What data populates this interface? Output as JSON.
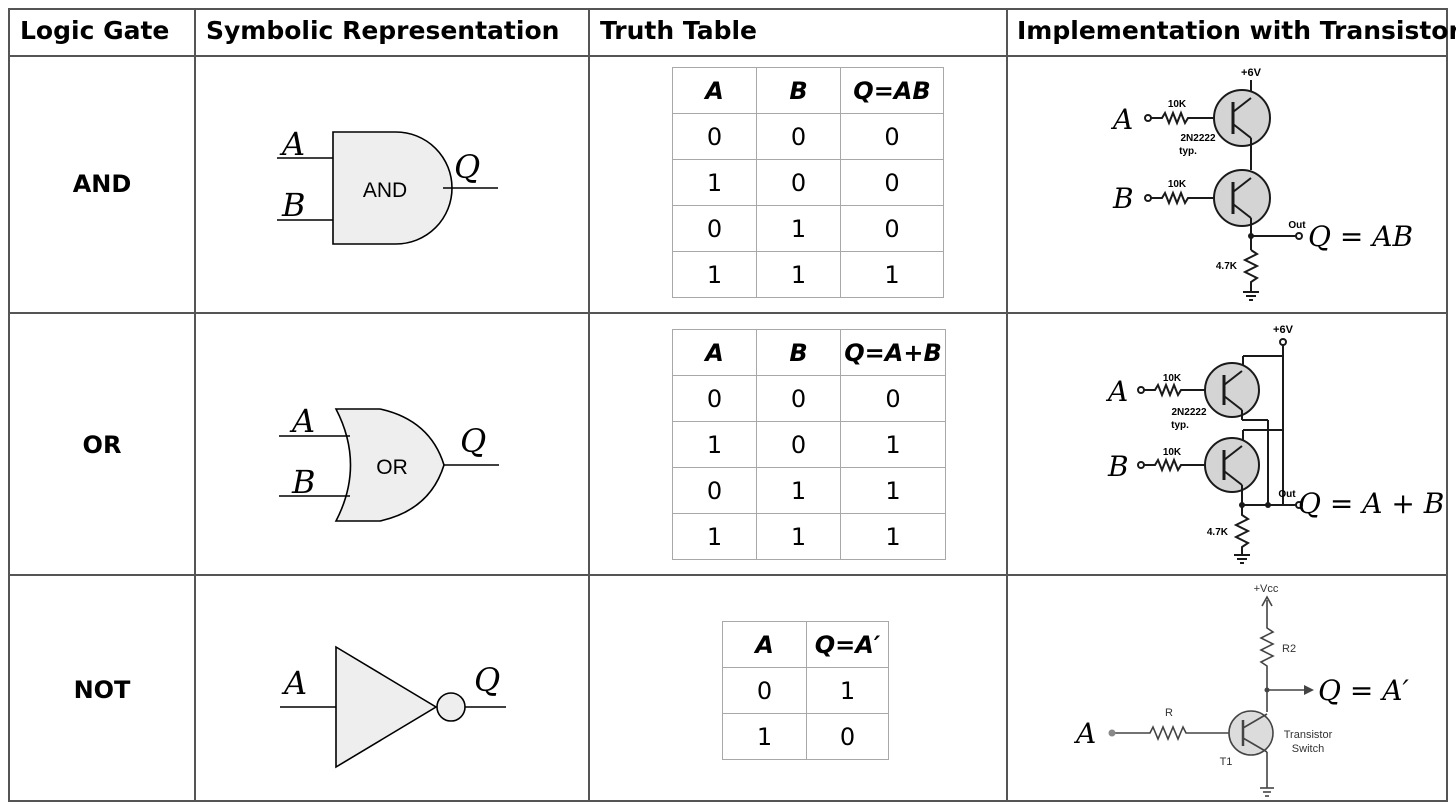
{
  "headers": {
    "gate": "Logic Gate",
    "symbol": "Symbolic Representation",
    "truth": "Truth Table",
    "impl": "Implementation with Transistors"
  },
  "rows": [
    {
      "gate": "AND",
      "symbol": {
        "in_a": "A",
        "in_b": "B",
        "out": "Q",
        "label": "AND"
      },
      "truth_table": {
        "columns": [
          "A",
          "B",
          "Q=AB"
        ],
        "rows": [
          [
            "0",
            "0",
            "0"
          ],
          [
            "1",
            "0",
            "0"
          ],
          [
            "0",
            "1",
            "0"
          ],
          [
            "1",
            "1",
            "1"
          ]
        ]
      },
      "circuit": {
        "supply": "+6V",
        "in_a": "A",
        "in_b": "B",
        "r_a": "10K",
        "r_b": "10K",
        "transistor": "2N2222",
        "typ": "typ.",
        "r_load": "4.7K",
        "out_label": "Out",
        "expr": "Q = AB"
      }
    },
    {
      "gate": "OR",
      "symbol": {
        "in_a": "A",
        "in_b": "B",
        "out": "Q",
        "label": "OR"
      },
      "truth_table": {
        "columns": [
          "A",
          "B",
          "Q=A+B"
        ],
        "rows": [
          [
            "0",
            "0",
            "0"
          ],
          [
            "1",
            "0",
            "1"
          ],
          [
            "0",
            "1",
            "1"
          ],
          [
            "1",
            "1",
            "1"
          ]
        ]
      },
      "circuit": {
        "supply": "+6V",
        "in_a": "A",
        "in_b": "B",
        "r_a": "10K",
        "r_b": "10K",
        "transistor": "2N2222",
        "typ": "typ.",
        "r_load": "4.7K",
        "out_label": "Out",
        "expr": "Q = A + B"
      }
    },
    {
      "gate": "NOT",
      "symbol": {
        "in_a": "A",
        "out": "Q"
      },
      "truth_table": {
        "columns": [
          "A",
          "Q=A′"
        ],
        "rows": [
          [
            "0",
            "1"
          ],
          [
            "1",
            "0"
          ]
        ]
      },
      "circuit": {
        "supply": "+Vcc",
        "in_a": "A",
        "r_in": "R",
        "r_c": "R2",
        "t_label": "T1",
        "switch_l1": "Transistor",
        "switch_l2": "Switch",
        "expr": "Q = A′"
      }
    }
  ]
}
